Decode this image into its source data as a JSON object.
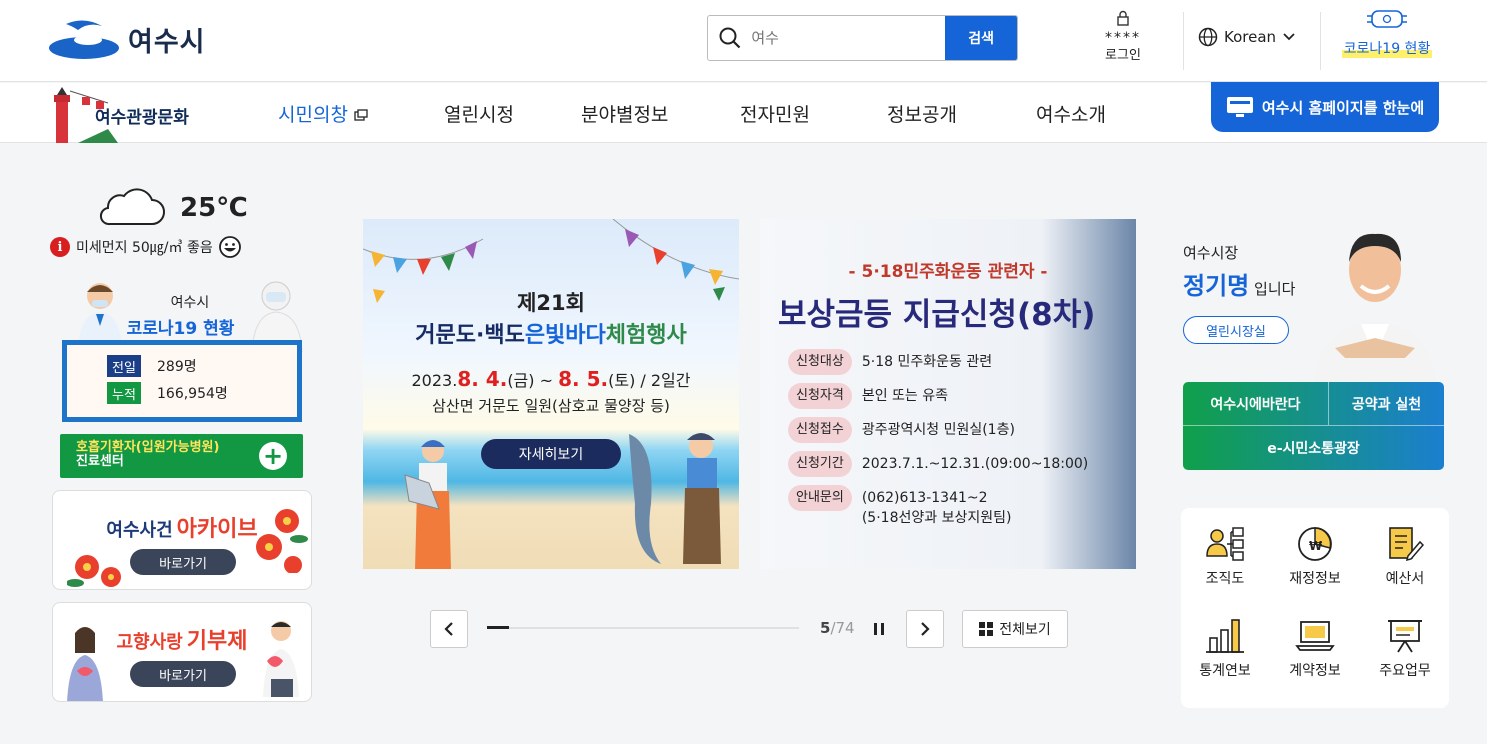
{
  "header": {
    "site_name": "여수시",
    "search_placeholder": "여수",
    "search_button": "검색",
    "login_stars": "****",
    "login_label": "로그인",
    "language": "Korean",
    "corona_label": "코로나19 현황"
  },
  "nav": {
    "tour_label": "여수관광문화",
    "items": [
      "시민의창",
      "열린시정",
      "분야별정보",
      "전자민원",
      "정보공개",
      "여수소개"
    ],
    "all_site_button": "여수시 홈페이지를 한눈에"
  },
  "weather": {
    "temperature": "25℃",
    "dust_text": "미세먼지 50㎍/㎥ 좋음"
  },
  "covid": {
    "city": "여수시",
    "title": "코로나19 현황",
    "rows": [
      {
        "tag": "전일",
        "value": "289명",
        "color": "#1a3e87"
      },
      {
        "tag": "누적",
        "value": "166,954명",
        "color": "#129743"
      }
    ],
    "clinic_title": "호흡기환자(입원가능병원)",
    "clinic_sub": "진료센터"
  },
  "archive": {
    "title_part1": "여수사건",
    "title_part2": "아카이브",
    "button": "바로가기"
  },
  "donation": {
    "title_part1": "고향사랑",
    "title_part2": "기부제",
    "button": "바로가기"
  },
  "banner1": {
    "title1": "제21회",
    "title2_a": "거문도·백도",
    "title2_b": "은빛바다",
    "title2_c": "체험행사",
    "date_prefix": "2023.",
    "date_d1": "8. 4.",
    "date_mid1": "(금) ~ ",
    "date_d2": "8. 5.",
    "date_mid2": "(토) / 2일간",
    "place": "삼산면 거문도 일원(삼호교 물양장 등)",
    "button": "자세히보기"
  },
  "banner2": {
    "subtitle": "- 5·18민주화운동 관련자 -",
    "title": "보상금등 지급신청(8차)",
    "rows": [
      {
        "label": "신청대상",
        "value": "5·18 민주화운동 관련"
      },
      {
        "label": "신청자격",
        "value": "본인 또는 유족"
      },
      {
        "label": "신청접수",
        "value": "광주광역시청 민원실(1층)"
      },
      {
        "label": "신청기간",
        "value": "2023.7.1.~12.31.(09:00~18:00)"
      },
      {
        "label": "안내문의",
        "value": "(062)613-1341~2",
        "value2": "(5·18선양과 보상지원팀)"
      }
    ]
  },
  "slider": {
    "current": "5",
    "total": "/74",
    "all_view": "전체보기"
  },
  "mayor": {
    "label": "여수시장",
    "name": "정기명",
    "suffix": " 입니다",
    "open_button": "열린시장실",
    "links": [
      "여수시에바란다",
      "공약과 실천",
      "e-시민소통광장"
    ]
  },
  "quick_links": [
    "조직도",
    "재정정보",
    "예산서",
    "통계연보",
    "계약정보",
    "주요업무"
  ]
}
